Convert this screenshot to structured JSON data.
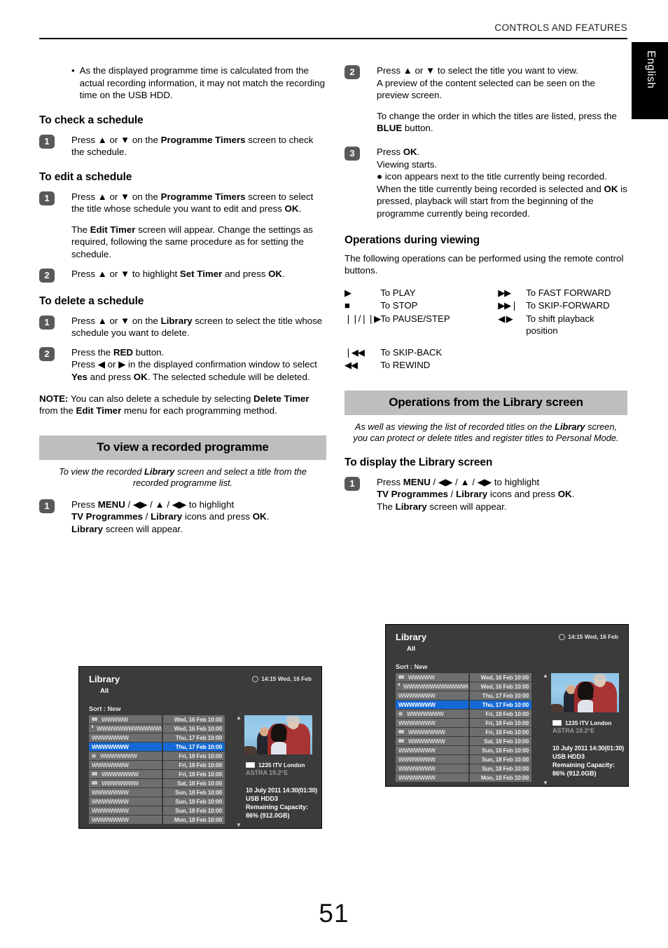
{
  "header": {
    "running_head": "CONTROLS AND FEATURES",
    "language_tab": "English"
  },
  "page_number": "51",
  "left_column": {
    "bullet": {
      "marker": "•",
      "text": "As the displayed programme time is calculated from the actual recording information, it may not match the recording time on the USB HDD."
    },
    "section_check": {
      "heading": "To check a schedule",
      "step1_badge": "1",
      "step1_html": "Press ▲ or ▼ on the <b>Programme Timers</b> screen to check the schedule."
    },
    "section_edit": {
      "heading": "To edit a schedule",
      "step1_badge": "1",
      "step1_html": "Press ▲ or ▼ on the <b>Programme Timers</b> screen to select the title whose schedule you want to edit and press <b>OK</b>.",
      "step1_extra_html": "The <b>Edit Timer</b> screen will appear. Change the settings as required, following the same procedure as for setting the schedule.",
      "step2_badge": "2",
      "step2_html": "Press ▲ or ▼ to highlight <b>Set Timer</b> and press <b>OK</b>."
    },
    "section_delete": {
      "heading": "To delete a schedule",
      "step1_badge": "1",
      "step1_html": "Press ▲ or ▼ on the <b>Library</b> screen to select the title whose schedule you want to delete.",
      "step2_badge": "2",
      "step2_html": "Press the <b>RED</b> button.<br>Press ◀ or ▶ in the displayed confirmation window to select <b>Yes</b> and press <b>OK</b>. The selected schedule will be deleted.",
      "note_html": "<b>NOTE:</b> You can also delete a schedule by selecting <b>Delete Timer</b> from the <b>Edit Timer</b> menu for each programming method."
    },
    "section_view": {
      "banner": "To view a recorded programme",
      "banner_sub_html": "To view the recorded <b>Library</b> screen and select a title from the recorded programme list.",
      "step1_badge": "1",
      "step1_html": "Press <b>MENU</b> / ◀▶ / ▲ / ◀▶ to highlight<br><b>TV Programmes</b> / <b>Library</b> icons and press <b>OK</b>.<br><b>Library</b> screen will appear."
    }
  },
  "right_column": {
    "step2_badge": "2",
    "step2_html": "Press ▲ or ▼ to select the title you want to view.<br>A preview of the content selected can be seen on the preview screen.",
    "step2_extra_html": "To change the order in which the titles are listed, press the <b>BLUE</b> button.",
    "step3_badge": "3",
    "step3_html": "Press <b>OK</b>.<br>Viewing starts.<br>● icon appears next to the title currently being recorded.<br>When the title currently being recorded is selected and <b>OK</b> is pressed, playback will start from the beginning of the programme currently being recorded.",
    "ops_heading": "Operations during viewing",
    "ops_intro": "The following operations can be performed using the remote control buttons.",
    "ops_table": [
      {
        "sym_left": "▶",
        "label_left": "To PLAY",
        "sym_right": "▶▶",
        "label_right": "To FAST FORWARD"
      },
      {
        "sym_left": "■",
        "label_left": "To STOP",
        "sym_right": "▶▶❘",
        "label_right": "To SKIP-FORWARD"
      },
      {
        "sym_left": "❘❘/❘❘▶",
        "label_left": "To PAUSE/STEP",
        "sym_right": "◀ ▶",
        "label_right": "To shift playback position"
      },
      {
        "sym_left": "❘◀◀",
        "label_left": "To SKIP-BACK",
        "sym_right": "",
        "label_right": ""
      },
      {
        "sym_left": "◀◀",
        "label_left": "To REWIND",
        "sym_right": "",
        "label_right": ""
      }
    ],
    "library_banner": "Operations from the Library screen",
    "library_banner_sub_html": "As well as viewing the list of recorded titles on the <b>Library</b> screen, you can protect or delete titles and register titles to Personal Mode.",
    "display_heading": "To display the Library screen",
    "display_step1_badge": "1",
    "display_step1_html": "Press <b>MENU</b> / ◀▶ / ▲ / ◀▶ to highlight<br><b>TV Programmes</b> / <b>Library</b> icons and press <b>OK</b>.<br>The <b>Library</b> screen will appear."
  },
  "library_screen": {
    "title": "Library",
    "filter": "All",
    "clock": "14:15 Wed, 16 Feb",
    "sort_label": "Sort : New",
    "scroll_up": "▲",
    "scroll_down": "▼",
    "rows": [
      {
        "icon": "tape",
        "name": "WWWWW",
        "date": "Wed, 16 Feb 10:00",
        "selected": false
      },
      {
        "icon": "lock",
        "name": "WWWWWWWWWWWWW",
        "date": "Wed, 16 Feb 10:00",
        "selected": false
      },
      {
        "icon": "none",
        "name": "WWWWWWW",
        "date": "Thu, 17 Feb 10:00",
        "selected": false
      },
      {
        "icon": "none",
        "name": "WWWWWWW",
        "date": "Thu, 17 Feb 10:00",
        "selected": true
      },
      {
        "icon": "rec",
        "name": "WWWWWWW",
        "date": "Fri, 18 Feb 10:00",
        "selected": false
      },
      {
        "icon": "none",
        "name": "WWWWWWW",
        "date": "Fri, 18 Feb 10:00",
        "selected": false
      },
      {
        "icon": "tape",
        "name": "WWWWWWW",
        "date": "Fri, 18 Feb 10:00",
        "selected": false
      },
      {
        "icon": "tape",
        "name": "WWWWWWW",
        "date": "Sat, 18 Feb 10:00",
        "selected": false
      },
      {
        "icon": "none",
        "name": "WWWWWWW",
        "date": "Sun, 18 Feb 10:00",
        "selected": false
      },
      {
        "icon": "none",
        "name": "WWWWWWW",
        "date": "Sun, 18 Feb 10:00",
        "selected": false
      },
      {
        "icon": "none",
        "name": "WWWWWWW",
        "date": "Sun, 18 Feb 10:00",
        "selected": false
      },
      {
        "icon": "none",
        "name": "WWWWWWW",
        "date": "Mon, 18 Feb 10:00",
        "selected": false
      }
    ],
    "details": {
      "channel": "1235 ITV London",
      "satellite": "ASTRA 19.2°E",
      "datetime": "10 July 2011  14:30(01:30)",
      "device": "USB HDD3",
      "capacity_label": "Remaining Capacity:",
      "capacity_value": "86% (912.0GB)"
    }
  },
  "colors": {
    "banner_grey": "#bcbec0",
    "badge_grey": "#58595b",
    "screen_bg": "#3b3b3b",
    "row_bg": "#6d6e70",
    "row_selected": "#1569d6"
  }
}
